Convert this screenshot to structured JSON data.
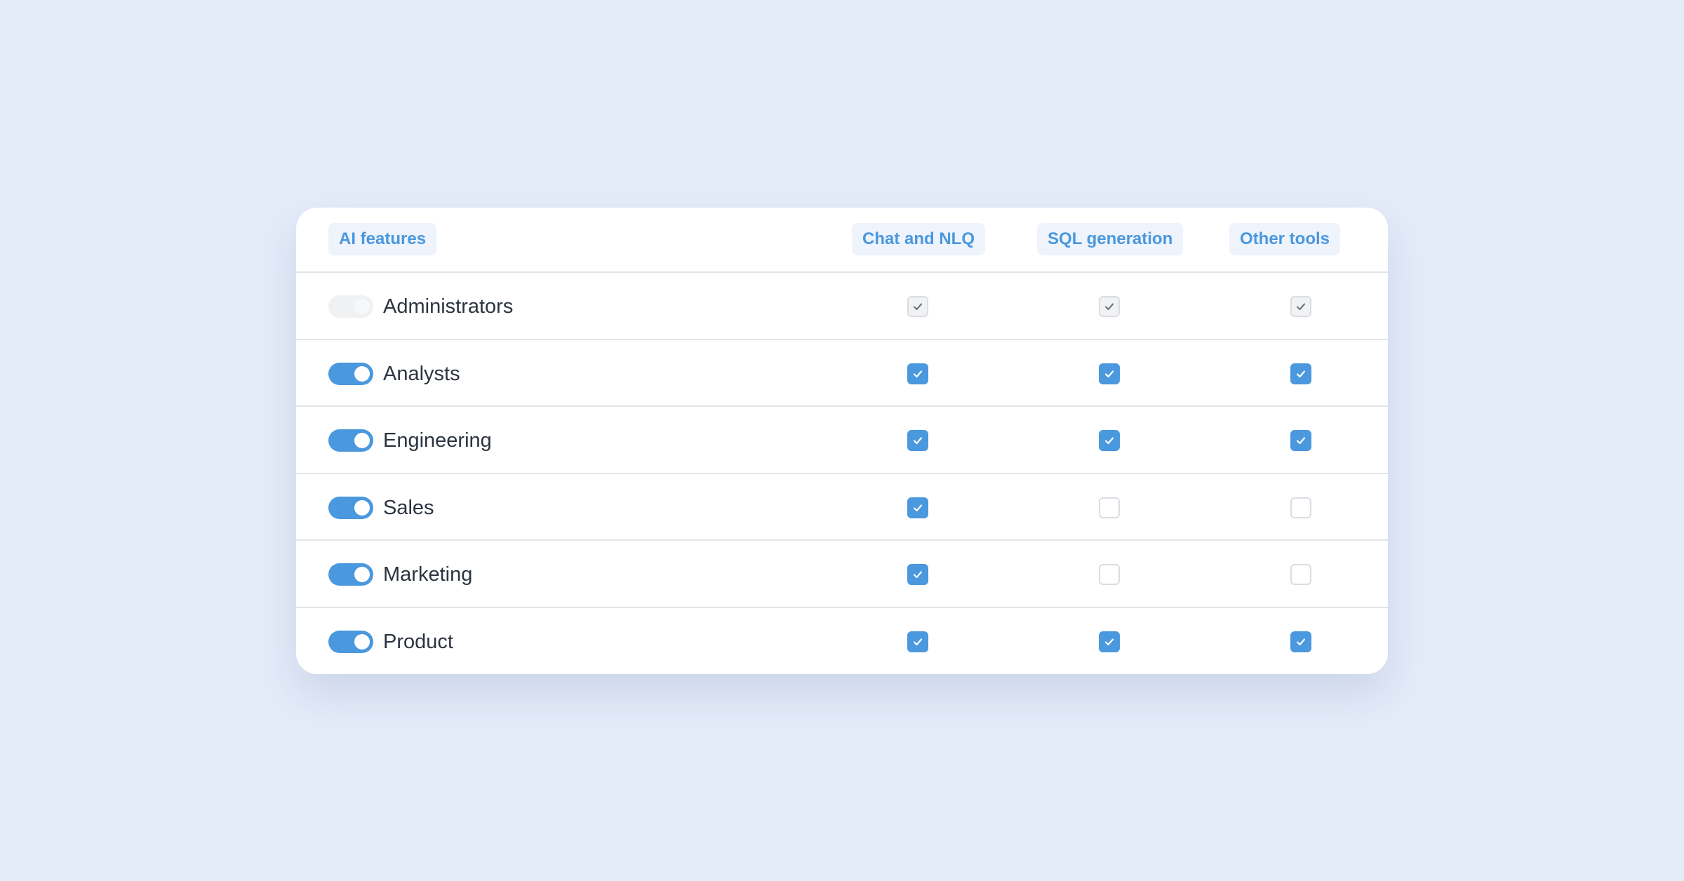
{
  "header": {
    "features_label": "AI features",
    "columns": [
      "Chat and NLQ",
      "SQL generation",
      "Other tools"
    ]
  },
  "rows": [
    {
      "label": "Administrators",
      "toggle": "disabled",
      "checks": [
        "disabled",
        "disabled",
        "disabled"
      ]
    },
    {
      "label": "Analysts",
      "toggle": "on",
      "checks": [
        "checked",
        "checked",
        "checked"
      ]
    },
    {
      "label": "Engineering",
      "toggle": "on",
      "checks": [
        "checked",
        "checked",
        "checked"
      ]
    },
    {
      "label": "Sales",
      "toggle": "on",
      "checks": [
        "checked",
        "unchecked",
        "unchecked"
      ]
    },
    {
      "label": "Marketing",
      "toggle": "on",
      "checks": [
        "checked",
        "unchecked",
        "unchecked"
      ]
    },
    {
      "label": "Product",
      "toggle": "on",
      "checks": [
        "checked",
        "checked",
        "checked"
      ]
    }
  ],
  "colors": {
    "background": "#e4ebf9",
    "accent": "#4a98de",
    "chip_background": "#eef3fc",
    "text": "#2c3440",
    "divider": "#e1e4ea"
  },
  "icons": {
    "check": "checkmark-icon"
  }
}
